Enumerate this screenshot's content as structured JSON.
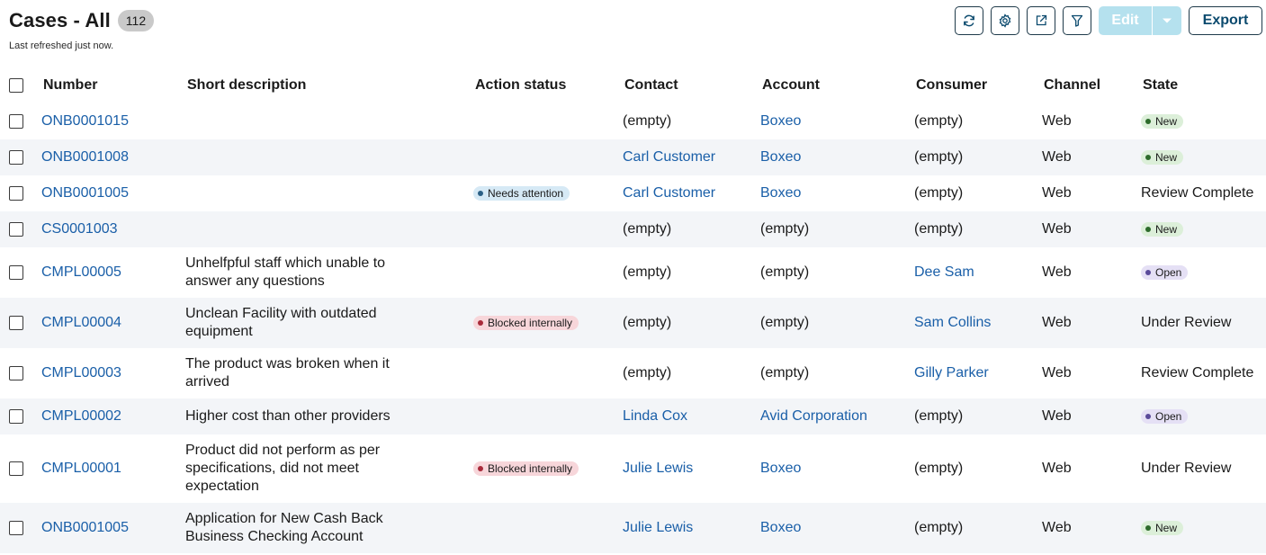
{
  "header": {
    "title": "Cases - All",
    "count": "112",
    "subtitle": "Last refreshed just now."
  },
  "toolbar": {
    "refresh_icon": "refresh-icon",
    "settings_icon": "gear-icon",
    "share_icon": "share-icon",
    "filter_icon": "filter-icon",
    "edit_label": "Edit",
    "export_label": "Export"
  },
  "colors": {
    "link": "#1a5fa8",
    "row_alt": "#f3f5f8",
    "edit_disabled": "#b5e1ee"
  },
  "columns": [
    "Number",
    "Short description",
    "Action status",
    "Contact",
    "Account",
    "Consumer",
    "Channel",
    "State"
  ],
  "rows": [
    {
      "number": "ONB0001015",
      "desc": "",
      "action": "",
      "action_type": "",
      "contact": "(empty)",
      "contact_link": false,
      "account": "Boxeo",
      "account_link": true,
      "consumer": "(empty)",
      "consumer_link": false,
      "channel": "Web",
      "state": "New",
      "state_type": "new"
    },
    {
      "number": "ONB0001008",
      "desc": "",
      "action": "",
      "action_type": "",
      "contact": "Carl Customer",
      "contact_link": true,
      "account": "Boxeo",
      "account_link": true,
      "consumer": "(empty)",
      "consumer_link": false,
      "channel": "Web",
      "state": "New",
      "state_type": "new"
    },
    {
      "number": "ONB0001005",
      "desc": "",
      "action": "Needs attention",
      "action_type": "attn",
      "contact": "Carl Customer",
      "contact_link": true,
      "account": "Boxeo",
      "account_link": true,
      "consumer": "(empty)",
      "consumer_link": false,
      "channel": "Web",
      "state": "Review Complete",
      "state_type": "text"
    },
    {
      "number": "CS0001003",
      "desc": "",
      "action": "",
      "action_type": "",
      "contact": "(empty)",
      "contact_link": false,
      "account": "(empty)",
      "account_link": false,
      "consumer": "(empty)",
      "consumer_link": false,
      "channel": "Web",
      "state": "New",
      "state_type": "new"
    },
    {
      "number": "CMPL00005",
      "desc": "Unhelfpful staff which unable to answer any questions",
      "action": "",
      "action_type": "",
      "contact": "(empty)",
      "contact_link": false,
      "account": "(empty)",
      "account_link": false,
      "consumer": "Dee Sam",
      "consumer_link": true,
      "channel": "Web",
      "state": "Open",
      "state_type": "open"
    },
    {
      "number": "CMPL00004",
      "desc": "Unclean Facility with outdated equipment",
      "action": "Blocked internally",
      "action_type": "blocked",
      "contact": "(empty)",
      "contact_link": false,
      "account": "(empty)",
      "account_link": false,
      "consumer": "Sam Collins",
      "consumer_link": true,
      "channel": "Web",
      "state": "Under Review",
      "state_type": "text"
    },
    {
      "number": "CMPL00003",
      "desc": "The product was broken when it arrived",
      "action": "",
      "action_type": "",
      "contact": "(empty)",
      "contact_link": false,
      "account": "(empty)",
      "account_link": false,
      "consumer": "Gilly Parker",
      "consumer_link": true,
      "channel": "Web",
      "state": "Review Complete",
      "state_type": "text"
    },
    {
      "number": "CMPL00002",
      "desc": "Higher cost than other providers",
      "action": "",
      "action_type": "",
      "contact": "Linda Cox",
      "contact_link": true,
      "account": "Avid Corporation",
      "account_link": true,
      "consumer": "(empty)",
      "consumer_link": false,
      "channel": "Web",
      "state": "Open",
      "state_type": "open"
    },
    {
      "number": "CMPL00001",
      "desc": "Product did not perform as per specifications, did not meet expectation",
      "action": "Blocked internally",
      "action_type": "blocked",
      "contact": "Julie Lewis",
      "contact_link": true,
      "account": "Boxeo",
      "account_link": true,
      "consumer": "(empty)",
      "consumer_link": false,
      "channel": "Web",
      "state": "Under Review",
      "state_type": "text"
    },
    {
      "number": "ONB0001005",
      "desc": "Application for New Cash Back Business Checking Account",
      "action": "",
      "action_type": "",
      "contact": "Julie Lewis",
      "contact_link": true,
      "account": "Boxeo",
      "account_link": true,
      "consumer": "(empty)",
      "consumer_link": false,
      "channel": "Web",
      "state": "New",
      "state_type": "new"
    }
  ]
}
